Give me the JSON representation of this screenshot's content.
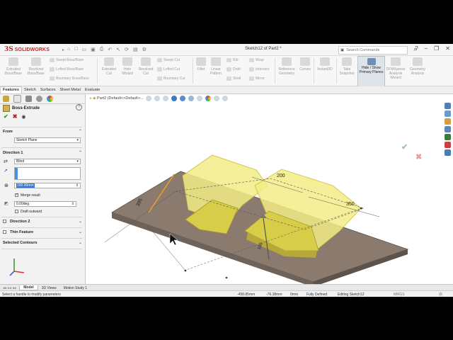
{
  "app": {
    "logo_ds": "3S",
    "logo_text": "SOLIDWORKS",
    "document_title": "Sketch12 of Part2 *",
    "search_placeholder": "Search Commands"
  },
  "command_manager": {
    "extruded_boss": "Extruded Boss/Base",
    "revolved_boss": "Revolved Boss/Base",
    "swept_boss": "Swept Boss/Base",
    "lofted_boss": "Lofted Boss/Base",
    "boundary_boss": "Boundary Boss/Base",
    "extruded_cut": "Extruded Cut",
    "hole_wizard": "Hole Wizard",
    "revolved_cut": "Revolved Cut",
    "swept_cut": "Swept Cut",
    "lofted_cut": "Lofted Cut",
    "boundary_cut": "Boundary Cut",
    "fillet": "Fillet",
    "linear_pattern": "Linear Pattern",
    "rib": "Rib",
    "draft": "Draft",
    "shell": "Shell",
    "wrap": "Wrap",
    "intersect": "Intersect",
    "mirror": "Mirror",
    "reference_geometry": "Reference Geometry",
    "curves": "Curves",
    "instant3d": "Instant3D",
    "take_snapshot": "Take Snapshot",
    "hide_show_planes": "Hide / Show Primary Planes",
    "dfmxpress": "DFMXpress Analysis Wizard",
    "geometry_analysis": "Geometry Analysis"
  },
  "tabs": [
    "Features",
    "Sketch",
    "Surfaces",
    "Sheet Metal",
    "Evaluate"
  ],
  "property_manager": {
    "feature_name": "Boss-Extrude",
    "help": "?",
    "from_label": "From",
    "from_value": "Sketch Plane",
    "direction1_label": "Direction 1",
    "end_condition": "Blind",
    "depth_value": "100.00mm",
    "merge_result": "Merge result",
    "draft_angle": "0.00deg",
    "draft_outward": "Draft outward",
    "direction2_label": "Direction 2",
    "thin_feature_label": "Thin Feature",
    "selected_contours_label": "Selected Contours"
  },
  "viewport": {
    "breadcrumb": "Part2  (Default<<Default>...",
    "dim_top": "200",
    "dim_right": "350",
    "dim_left": "395",
    "dim_depth": "100"
  },
  "bottom_tabs": [
    "Model",
    "3D Views",
    "Motion Study 1"
  ],
  "status": {
    "message": "Select a handle to modify parameters",
    "x": "-458.85mm",
    "y": "-76.38mm",
    "z": "0mm",
    "defined": "Fully Defined",
    "editing": "Editing Sketch12",
    "units": "MMGS"
  }
}
